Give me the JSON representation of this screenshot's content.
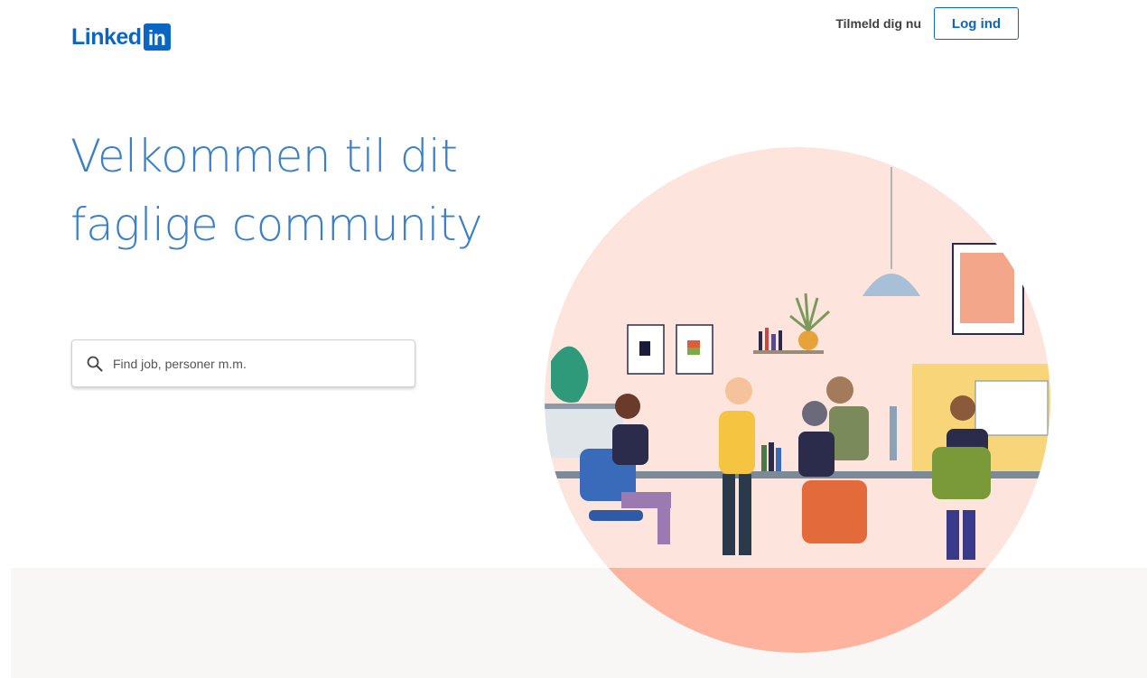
{
  "header": {
    "logo_text": "Linked",
    "logo_box_text": "in",
    "join_label": "Tilmeld dig nu",
    "signin_label": "Log ind"
  },
  "hero": {
    "headline": "Velkommen til dit faglige community"
  },
  "search": {
    "placeholder": "Find job, personer m.m."
  },
  "colors": {
    "brand": "#0a66c2",
    "headline": "#3b80c6",
    "circle": "#fde4dc",
    "floor": "#fdb39e",
    "band": "#f8f7f5"
  },
  "illustration": {
    "icon": "office-people-illustration"
  }
}
